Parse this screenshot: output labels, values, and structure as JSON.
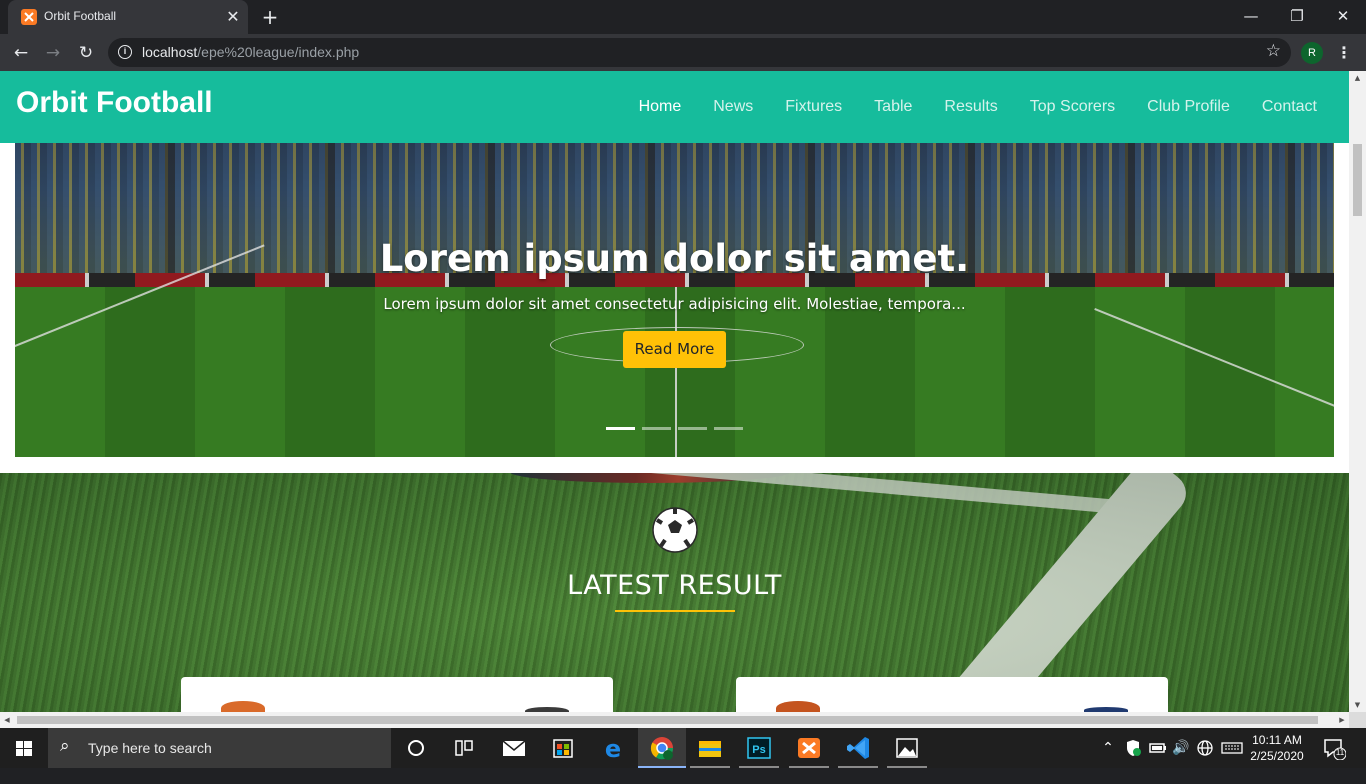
{
  "browser": {
    "tab_title": "Orbit Football",
    "tab_close": "✕",
    "new_tab": "+",
    "url_host": "localhost",
    "url_path": "/epe%20league/index.php",
    "profile_initial": "R",
    "window_controls": {
      "minimize": "—",
      "restore": "❐",
      "close": "✕"
    }
  },
  "site": {
    "brand": "Orbit Football",
    "nav": [
      {
        "label": "Home",
        "active": true
      },
      {
        "label": "News"
      },
      {
        "label": "Fixtures"
      },
      {
        "label": "Table"
      },
      {
        "label": "Results"
      },
      {
        "label": "Top Scorers"
      },
      {
        "label": "Club Profile"
      },
      {
        "label": "Contact"
      }
    ],
    "accent_color": "#16bc9c"
  },
  "hero": {
    "title": "Lorem ipsum dolor sit amet.",
    "text": "Lorem ipsum dolor sit amet consectetur adipisicing elit. Molestiae, tempora...",
    "button": "Read More",
    "button_color": "#ffc107",
    "slides": 4,
    "active_slide": 1
  },
  "latest_result": {
    "heading": "LATEST RESULT",
    "icon": "soccer-ball-icon"
  },
  "taskbar": {
    "search_placeholder": "Type here to search",
    "time": "10:11 AM",
    "date": "2/25/2020",
    "notification_count": "11"
  }
}
